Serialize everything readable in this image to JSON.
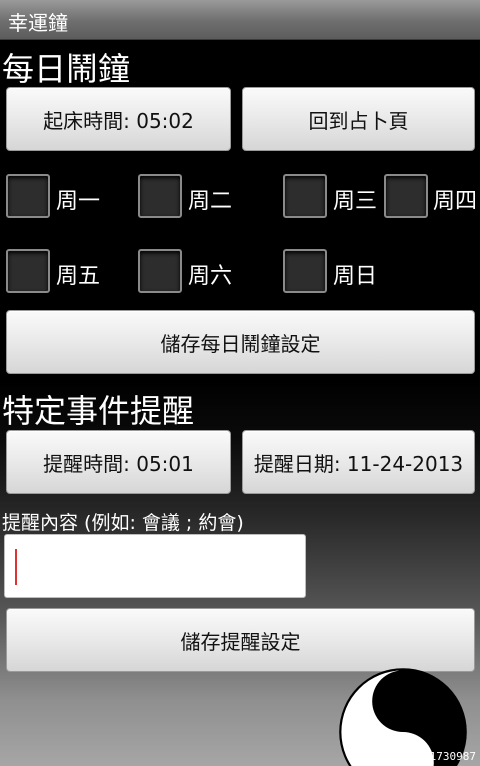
{
  "app": {
    "title": "幸運鐘"
  },
  "daily_alarm": {
    "heading": "每日鬧鐘",
    "wake_time_button": "起床時間: 05:02",
    "back_button": "回到占卜頁",
    "days": [
      {
        "label": "周一",
        "checked": false
      },
      {
        "label": "周二",
        "checked": false
      },
      {
        "label": "周三",
        "checked": false
      },
      {
        "label": "周四",
        "checked": false
      },
      {
        "label": "周五",
        "checked": false
      },
      {
        "label": "周六",
        "checked": false
      },
      {
        "label": "周日",
        "checked": false
      }
    ],
    "save_button": "儲存每日鬧鐘設定"
  },
  "event_reminder": {
    "heading": "特定事件提醒",
    "time_button": "提醒時間: 05:01",
    "date_button": "提醒日期: 11-24-2013",
    "content_label": "提醒內容 (例如: 會議 ; 約會)",
    "content_value": "",
    "save_button": "儲存提醒設定"
  },
  "decoration": {
    "icon": "yin-yang-icon"
  },
  "watermark": "#1730987",
  "colors": {
    "background": "#000000",
    "button": "#e9e9e9",
    "caret": "#dd3333"
  }
}
